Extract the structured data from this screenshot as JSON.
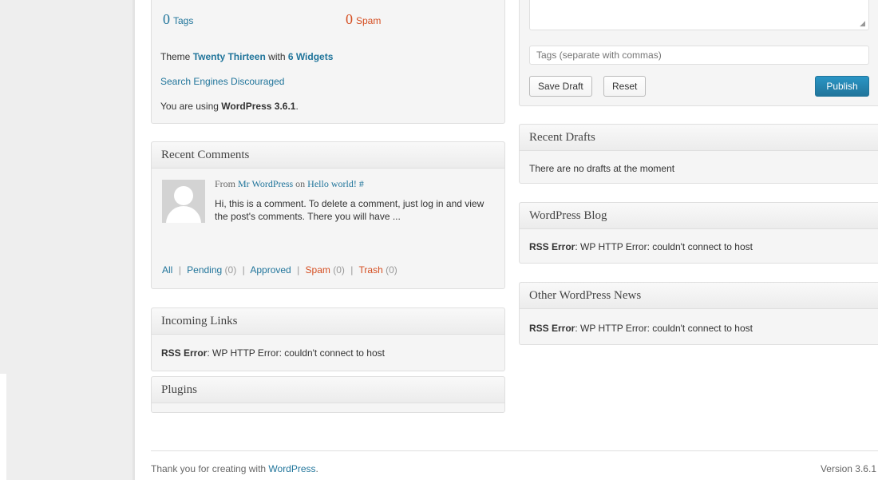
{
  "right_now": {
    "tags_count": "0",
    "tags_label": "Tags",
    "spam_count": "0",
    "spam_label": "Spam",
    "theme_prefix": "Theme ",
    "theme_name": "Twenty Thirteen",
    "theme_with": " with ",
    "widgets_link": "6 Widgets",
    "search_engines": "Search Engines Discouraged",
    "version_prefix": "You are using ",
    "version_name": "WordPress 3.6.1",
    "version_suffix": "."
  },
  "recent_comments": {
    "title": "Recent Comments",
    "from_label": "From ",
    "author": "Mr WordPress",
    "on_label": " on ",
    "post": "Hello world!",
    "hash": " #",
    "excerpt": "Hi, this is a comment. To delete a comment, just log in and view the post's comments. There you will have ...",
    "links": {
      "all": "All",
      "pending": "Pending",
      "pending_count": "(0)",
      "approved": "Approved",
      "spam": "Spam",
      "spam_count": "(0)",
      "trash": "Trash",
      "trash_count": "(0)",
      "separator": "|"
    }
  },
  "incoming_links": {
    "title": "Incoming Links",
    "error_label": "RSS Error",
    "error_text": ": WP HTTP Error: couldn't connect to host"
  },
  "plugins": {
    "title": "Plugins"
  },
  "quickpress": {
    "tags_placeholder": "Tags (separate with commas)",
    "save_draft": "Save Draft",
    "reset": "Reset",
    "publish": "Publish"
  },
  "recent_drafts": {
    "title": "Recent Drafts",
    "empty": "There are no drafts at the moment"
  },
  "wordpress_blog": {
    "title": "WordPress Blog",
    "error_label": "RSS Error",
    "error_text": ": WP HTTP Error: couldn't connect to host"
  },
  "other_news": {
    "title": "Other WordPress News",
    "error_label": "RSS Error",
    "error_text": ": WP HTTP Error: couldn't connect to host"
  },
  "footer": {
    "thanks_prefix": "Thank you for creating with ",
    "thanks_link": "WordPress",
    "thanks_suffix": ".",
    "version": "Version 3.6.1"
  },
  "colors": {
    "link": "#21759b",
    "spam": "#d54e21",
    "publish_button": "#21759b"
  }
}
